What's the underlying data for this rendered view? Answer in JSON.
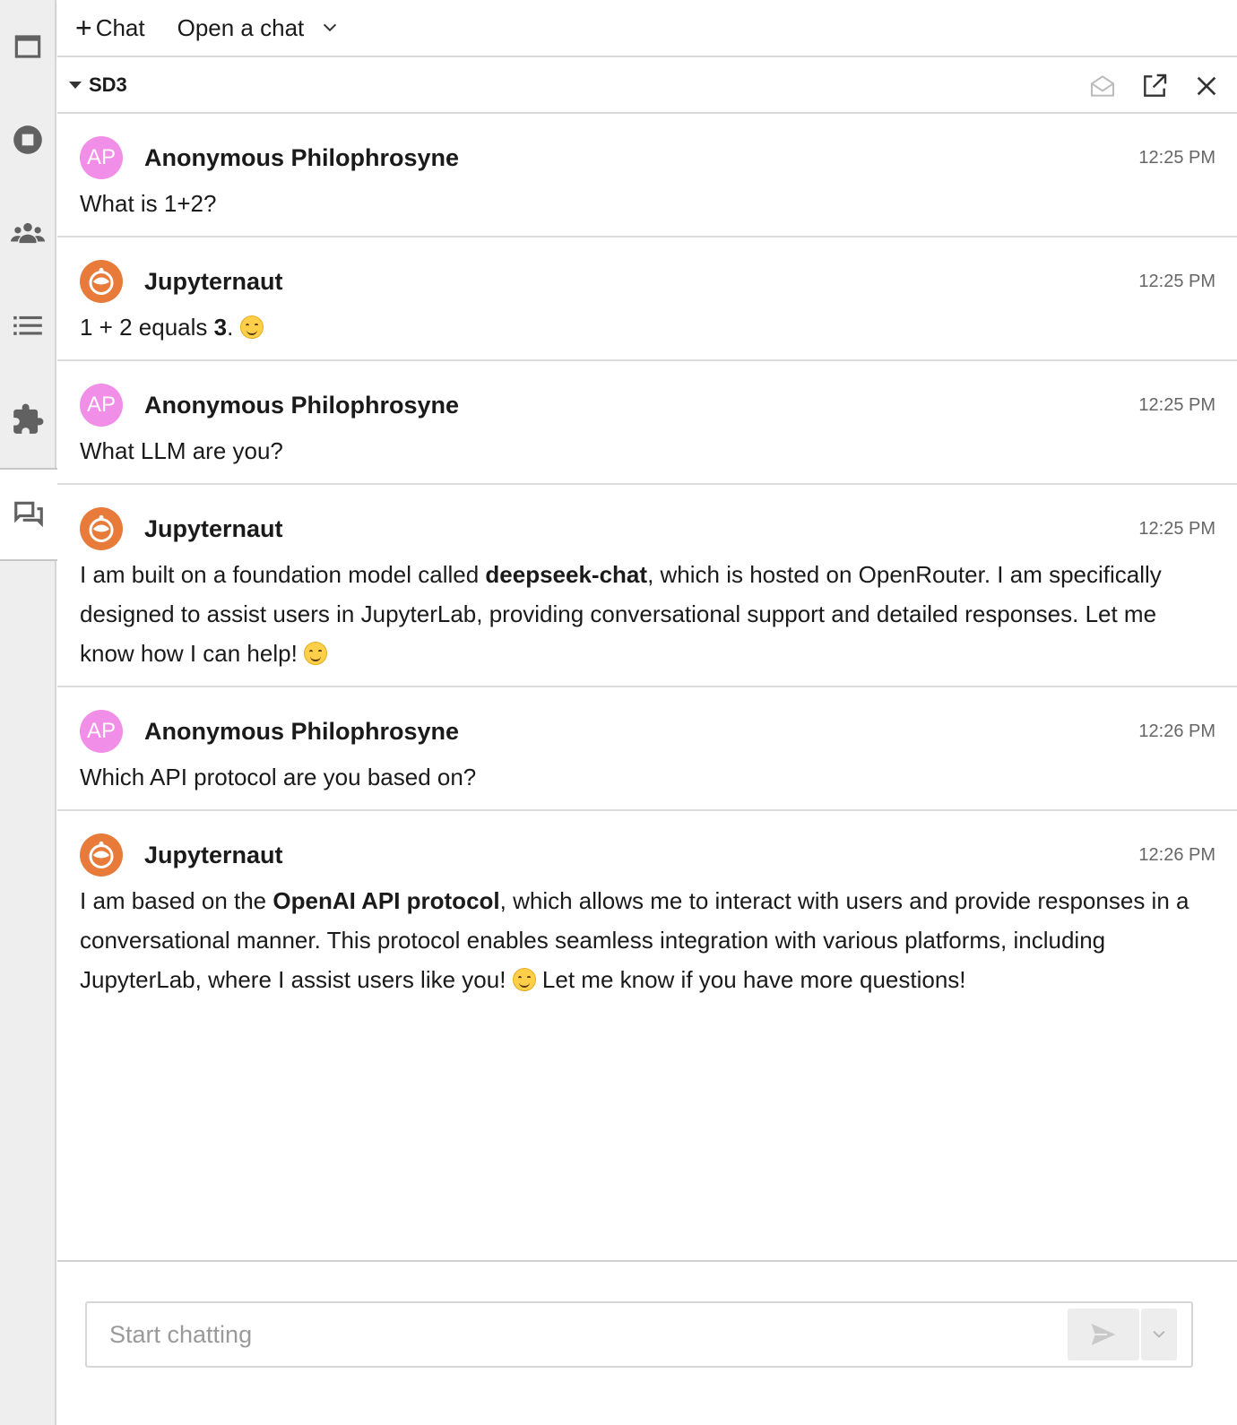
{
  "sidebar": {
    "icons": [
      "files-icon",
      "running-icon",
      "collaborators-icon",
      "toc-icon",
      "extensions-icon",
      "chat-icon"
    ],
    "active": "chat-icon"
  },
  "toolbar": {
    "new_chat_label": "Chat",
    "open_chat_label": "Open a chat"
  },
  "chat": {
    "title": "SD3"
  },
  "messages": [
    {
      "sender": "Anonymous Philophrosyne",
      "initials": "AP",
      "type": "user",
      "time": "12:25 PM",
      "text": "What is 1+2?"
    },
    {
      "sender": "Jupyternaut",
      "type": "bot",
      "time": "12:25 PM",
      "parts": [
        "1 + 2 equals ",
        "3",
        "."
      ]
    },
    {
      "sender": "Anonymous Philophrosyne",
      "initials": "AP",
      "type": "user",
      "time": "12:25 PM",
      "text": "What LLM are you?"
    },
    {
      "sender": "Jupyternaut",
      "type": "bot",
      "time": "12:25 PM",
      "parts": [
        "I am built on a foundation model called ",
        "deepseek-chat",
        ", which is hosted on OpenRouter. I am specifically designed to assist users in JupyterLab, providing conversational support and detailed responses. Let me know how I can help!"
      ]
    },
    {
      "sender": "Anonymous Philophrosyne",
      "initials": "AP",
      "type": "user",
      "time": "12:26 PM",
      "text": "Which API protocol are you based on?"
    },
    {
      "sender": "Jupyternaut",
      "type": "bot",
      "time": "12:26 PM",
      "parts": [
        "I am based on the ",
        "OpenAI API protocol",
        ", which allows me to interact with users and provide responses in a conversational manner. This protocol enables seamless integration with various platforms, including JupyterLab, where I assist users like you!",
        "Let me know if you have more questions!"
      ]
    }
  ],
  "input": {
    "placeholder": "Start chatting"
  },
  "colors": {
    "user_avatar": "#f08ee8",
    "bot_avatar": "#e87b3a",
    "sidebar_bg": "#eeeeee",
    "timestamp": "#666666"
  }
}
